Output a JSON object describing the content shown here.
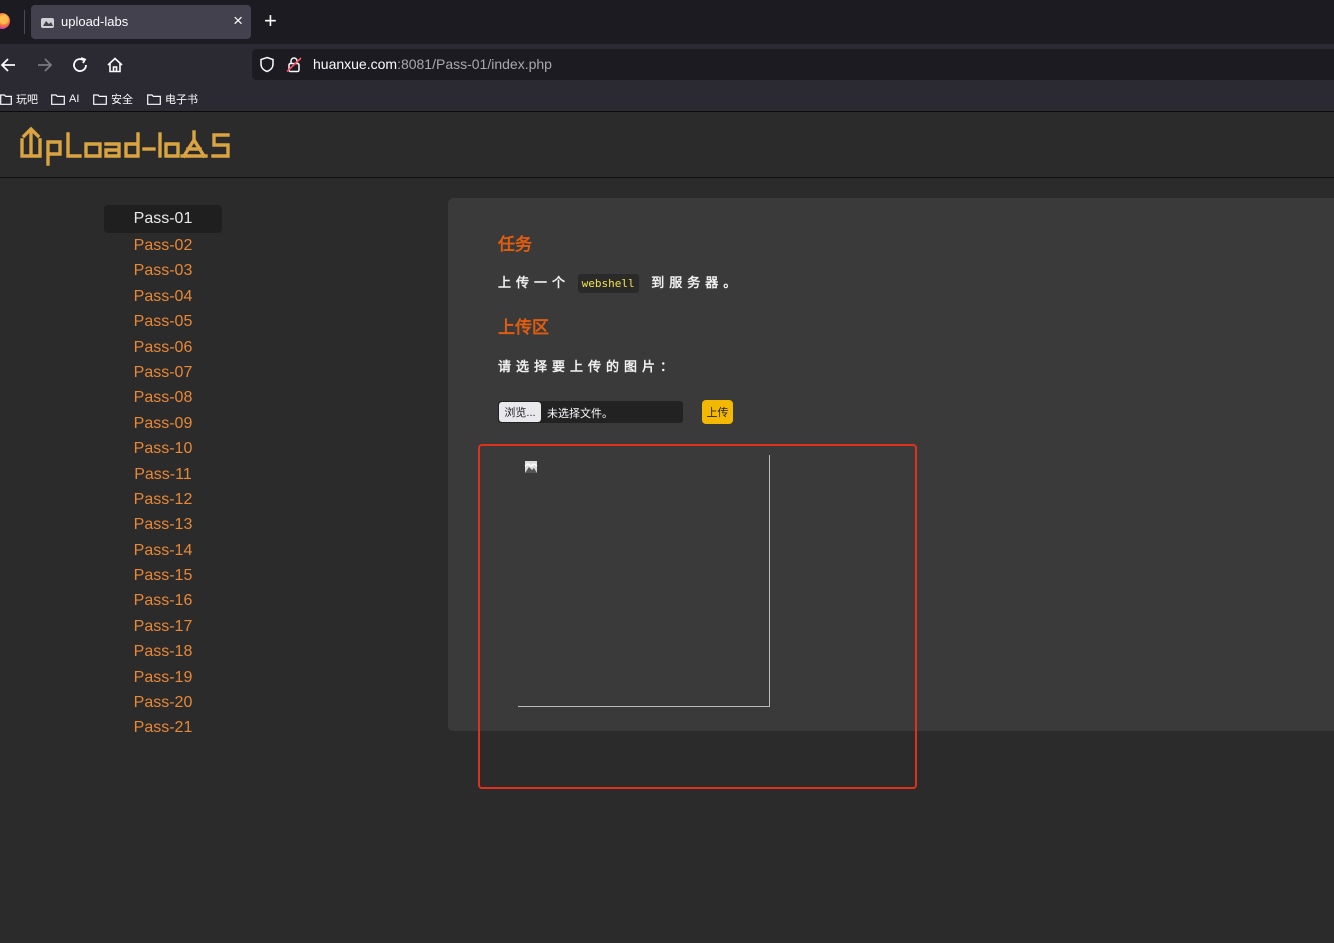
{
  "browser": {
    "tab_title": "upload-labs",
    "close_symbol": "×",
    "new_tab_symbol": "+",
    "url_host": "huanxue.com",
    "url_rest": ":8081/Pass-01/index.php",
    "bookmarks": [
      "玩吧",
      "AI",
      "安全",
      "电子书"
    ]
  },
  "page": {
    "logo_text": "Upload-labs",
    "nav": [
      "Pass-01",
      "Pass-02",
      "Pass-03",
      "Pass-04",
      "Pass-05",
      "Pass-06",
      "Pass-07",
      "Pass-08",
      "Pass-09",
      "Pass-10",
      "Pass-11",
      "Pass-12",
      "Pass-13",
      "Pass-14",
      "Pass-15",
      "Pass-16",
      "Pass-17",
      "Pass-18",
      "Pass-19",
      "Pass-20",
      "Pass-21"
    ],
    "active_nav": "Pass-01",
    "task_heading": "任务",
    "task_before": "上传一个",
    "task_code": "webshell",
    "task_after": "到服务器。",
    "upload_heading": "上传区",
    "choose_text": "请选择要上传的图片：",
    "browse_label": "浏览...",
    "file_status": "未选择文件。",
    "upload_button": "上传"
  },
  "colors": {
    "accent_orange": "#e88837",
    "heading": "#e05d10",
    "upload_button": "#f5b800",
    "highlight": "#e0301e"
  }
}
